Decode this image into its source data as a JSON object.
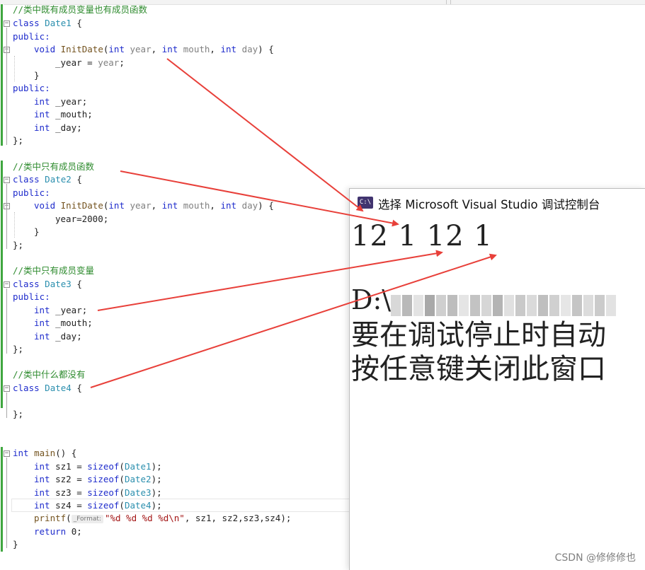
{
  "console": {
    "title": "选择 Microsoft Visual Studio 调试控制台",
    "icon": "console-app-icon",
    "output": "12  1  12  1",
    "path_prefix": "D:\\",
    "line_wait": "要在调试停止时自动",
    "line_close": "按任意键关闭此窗口"
  },
  "code": {
    "c1": "//类中既有成员变量也有成员函数",
    "c2": "//类中只有成员函数",
    "c3": "//类中只有成员变量",
    "c4": "//类中什么都没有",
    "kw_class": "class",
    "kw_public": "public:",
    "kw_int": "int",
    "kw_void": "void",
    "kw_return": "return",
    "kw_sizeof": "sizeof",
    "date1": "Date1",
    "date2": "Date2",
    "date3": "Date3",
    "date4": "Date4",
    "init_date": "InitDate",
    "p_year": "year",
    "p_mouth": "mouth",
    "p_day": "day",
    "m_year": "_year",
    "m_mouth": "_mouth",
    "m_day": "_day",
    "main": "main",
    "sz1": "sz1",
    "sz2": "sz2",
    "sz3": "sz3",
    "sz4": "sz4",
    "printf": "printf",
    "hint": "_Format:",
    "format_str": "\"%d %d %d %d\\n\"",
    "year_assign": "year=2000;",
    "zero": "0"
  },
  "watermark": "CSDN @修修修也",
  "colors": {
    "arrow": "#e8403a",
    "keyword": "#1f2ccc",
    "comment": "#2e8b2e",
    "type": "#2b8fae",
    "console_icon": "#41346f"
  }
}
